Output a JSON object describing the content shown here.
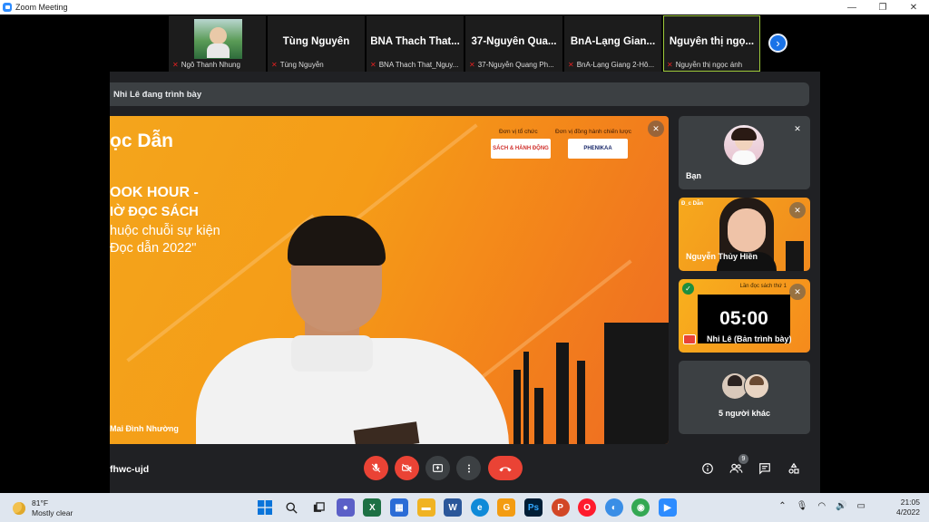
{
  "window": {
    "title": "Zoom Meeting",
    "minimize": "—",
    "maximize": "❐",
    "close": "✕"
  },
  "participants_strip": [
    {
      "tile_name": "",
      "footer_name": "Ngô Thanh Nhung"
    },
    {
      "tile_name": "Tùng Nguyễn",
      "footer_name": "Tùng Nguyễn"
    },
    {
      "tile_name": "BNA Thach That...",
      "footer_name": "BNA Thach That_Nguy..."
    },
    {
      "tile_name": "37-Nguyễn Qua...",
      "footer_name": "37-Nguyễn Quang Ph..."
    },
    {
      "tile_name": "BnA-Lạng Gian...",
      "footer_name": "BnA-Lạng Giang 2-Hô..."
    },
    {
      "tile_name": "Nguyễn thị ngọ...",
      "footer_name": "Nguyễn thị ngọc ánh"
    }
  ],
  "next_arrow": "›",
  "presenting_bar": "Nhi Lê đang trình bày",
  "main_tile": {
    "slide_title": "ọc Dẫn",
    "lines": [
      "OOK HOUR -",
      "IỜ ĐỌC SÁCH",
      "huộc chuỗi sự kiện",
      "Đọc dẫn 2022\""
    ],
    "organizer_label": "Đơn vị tổ chức",
    "partner_label": "Đơn vị đồng hành chiến lược",
    "logo1": "SÁCH & HÀNH ĐỘNG",
    "logo2": "PHENIKAA",
    "speaker_name": "Mai Đình Nhường"
  },
  "side_tiles": {
    "you": {
      "name": "Bạn"
    },
    "second": {
      "name": "Nguyễn Thủy Hiền",
      "slide_title": "Đ_c Dẫn"
    },
    "timer": {
      "time": "05:00",
      "name": "Nhi Lê (Bản trình bày)",
      "caption": "Lần đọc sách thứ 1"
    },
    "others": {
      "label": "5 người khác"
    }
  },
  "controls": {
    "meeting_code": "fhwc-ujd",
    "participants_badge": "9",
    "icons": {
      "mic": "mic-off-icon",
      "camera": "camera-off-icon",
      "present": "present-icon",
      "more": "more-icon",
      "hangup": "hangup-icon",
      "info": "info-icon",
      "people": "people-icon",
      "chat": "chat-icon",
      "activities": "activities-icon"
    }
  },
  "taskbar": {
    "weather_temp": "81°F",
    "weather_desc": "Mostly clear",
    "time": "21:05",
    "date": "4/2022"
  },
  "colors": {
    "accent": "#1a73e8",
    "danger": "#ea4335",
    "tile_bg": "#3c4043",
    "slide_orange": "#f59c17"
  }
}
